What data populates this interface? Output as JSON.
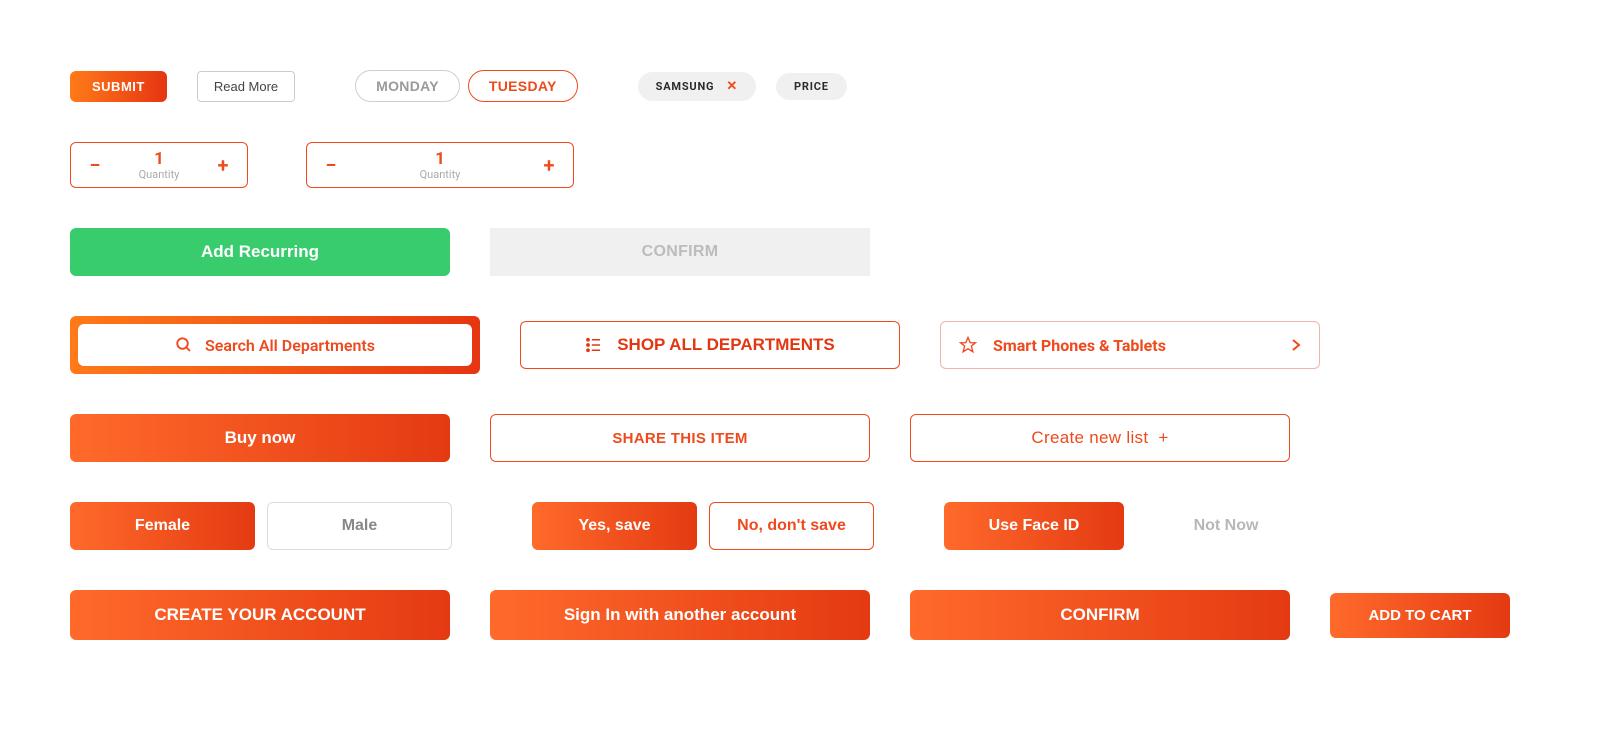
{
  "row1": {
    "submit": "SUBMIT",
    "readmore": "Read More",
    "monday": "MONDAY",
    "tuesday": "TUESDAY",
    "chip_samsung": "SAMSUNG",
    "chip_price": "PRICE"
  },
  "stepper": {
    "value1": "1",
    "value2": "1",
    "label": "Quantity"
  },
  "row3": {
    "add_recurring": "Add Recurring",
    "confirm": "CONFIRM"
  },
  "row4": {
    "search_placeholder": "Search All Departments",
    "shop_all": "SHOP ALL DEPARTMENTS",
    "category": "Smart Phones & Tablets"
  },
  "row5": {
    "buy_now": "Buy now",
    "share": "SHARE THIS ITEM",
    "create_list": "Create new list",
    "plus": "+"
  },
  "row6": {
    "female": "Female",
    "male": "Male",
    "yes_save": "Yes, save",
    "no_save": "No, don't save",
    "faceid": "Use Face ID",
    "notnow": "Not Now"
  },
  "row7": {
    "create_account": "CREATE YOUR ACCOUNT",
    "signin": "Sign In with another account",
    "confirm": "CONFIRM",
    "add_to_cart": "ADD TO CART"
  }
}
